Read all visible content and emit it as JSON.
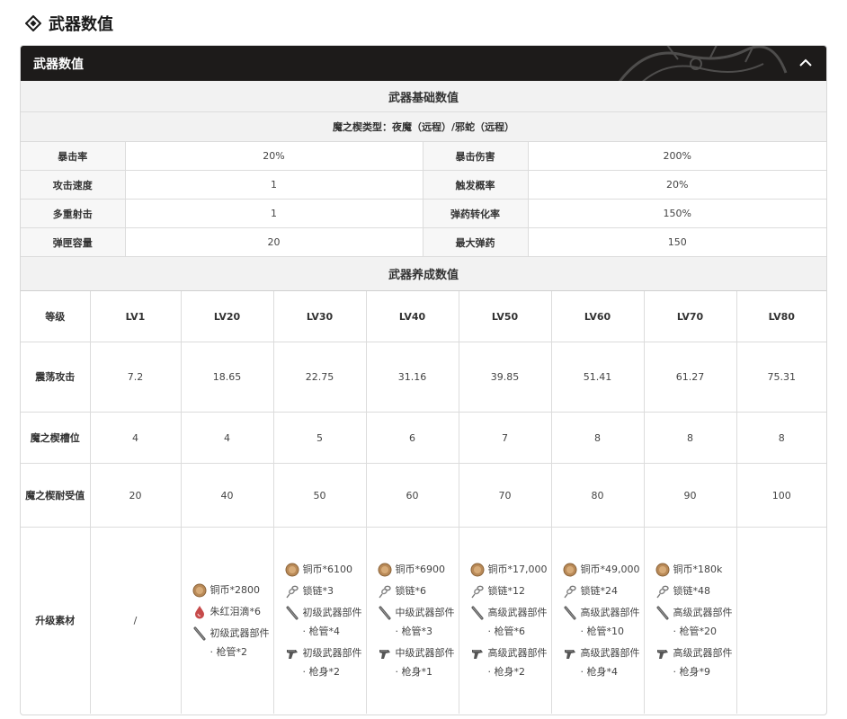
{
  "page": {
    "title": "武器数值"
  },
  "panel": {
    "title": "武器数值"
  },
  "basic": {
    "section_title": "武器基础数值",
    "subtype": "魔之楔类型：夜魔（远程）/邪蛇（远程）",
    "rows": [
      {
        "l1": "暴击率",
        "v1": "20%",
        "l2": "暴击伤害",
        "v2": "200%"
      },
      {
        "l1": "攻击速度",
        "v1": "1",
        "l2": "触发概率",
        "v2": "20%"
      },
      {
        "l1": "多重射击",
        "v1": "1",
        "l2": "弹药转化率",
        "v2": "150%"
      },
      {
        "l1": "弹匣容量",
        "v1": "20",
        "l2": "最大弹药",
        "v2": "150"
      }
    ]
  },
  "growth": {
    "section_title": "武器养成数值",
    "header_label": "等级",
    "levels": [
      "LV1",
      "LV20",
      "LV30",
      "LV40",
      "LV50",
      "LV60",
      "LV70",
      "LV80"
    ],
    "attack_label": "震荡攻击",
    "attack": [
      "7.2",
      "18.65",
      "22.75",
      "31.16",
      "39.85",
      "51.41",
      "61.27",
      "75.31"
    ],
    "slots_label": "魔之楔槽位",
    "slots": [
      "4",
      "4",
      "5",
      "6",
      "7",
      "8",
      "8",
      "8"
    ],
    "tolerance_label": "魔之楔耐受值",
    "tolerance": [
      "20",
      "40",
      "50",
      "60",
      "70",
      "80",
      "90",
      "100"
    ],
    "materials_label": "升级素材",
    "lv1_materials": "/",
    "materials": [
      [
        {
          "icon": "coin-icon",
          "text": "铜币*2800"
        },
        {
          "icon": "red-drop-icon",
          "text": "朱红泪滴*6"
        },
        {
          "icon": "barrel-icon",
          "text": "初级武器部件 · 枪管*2"
        }
      ],
      [
        {
          "icon": "coin-icon",
          "text": "铜币*6100"
        },
        {
          "icon": "chain-icon",
          "text": "锁链*3"
        },
        {
          "icon": "barrel-icon",
          "text": "初级武器部件 · 枪管*4"
        },
        {
          "icon": "gun-body-icon",
          "text": "初级武器部件 · 枪身*2"
        }
      ],
      [
        {
          "icon": "coin-icon",
          "text": "铜币*6900"
        },
        {
          "icon": "chain-icon",
          "text": "锁链*6"
        },
        {
          "icon": "barrel-icon",
          "text": "中级武器部件 · 枪管*3"
        },
        {
          "icon": "gun-body-icon",
          "text": "中级武器部件 · 枪身*1"
        }
      ],
      [
        {
          "icon": "coin-icon",
          "text": "铜币*17,000"
        },
        {
          "icon": "chain-icon",
          "text": "锁链*12"
        },
        {
          "icon": "barrel-icon",
          "text": "高级武器部件 · 枪管*6"
        },
        {
          "icon": "gun-body-icon",
          "text": "高级武器部件 · 枪身*2"
        }
      ],
      [
        {
          "icon": "coin-icon",
          "text": "铜币*49,000"
        },
        {
          "icon": "chain-icon",
          "text": "锁链*24"
        },
        {
          "icon": "barrel-icon",
          "text": "高级武器部件 · 枪管*10"
        },
        {
          "icon": "gun-body-icon",
          "text": "高级武器部件 · 枪身*4"
        }
      ],
      [
        {
          "icon": "coin-icon",
          "text": "铜币*180k"
        },
        {
          "icon": "chain-icon",
          "text": "锁链*48"
        },
        {
          "icon": "barrel-icon",
          "text": "高级武器部件 · 枪管*20"
        },
        {
          "icon": "gun-body-icon",
          "text": "高级武器部件 · 枪身*9"
        }
      ],
      []
    ]
  },
  "colors": {
    "header_bg": "#1d1b1a",
    "section_bg": "#f2f2f2",
    "border": "#dcdcdc"
  }
}
